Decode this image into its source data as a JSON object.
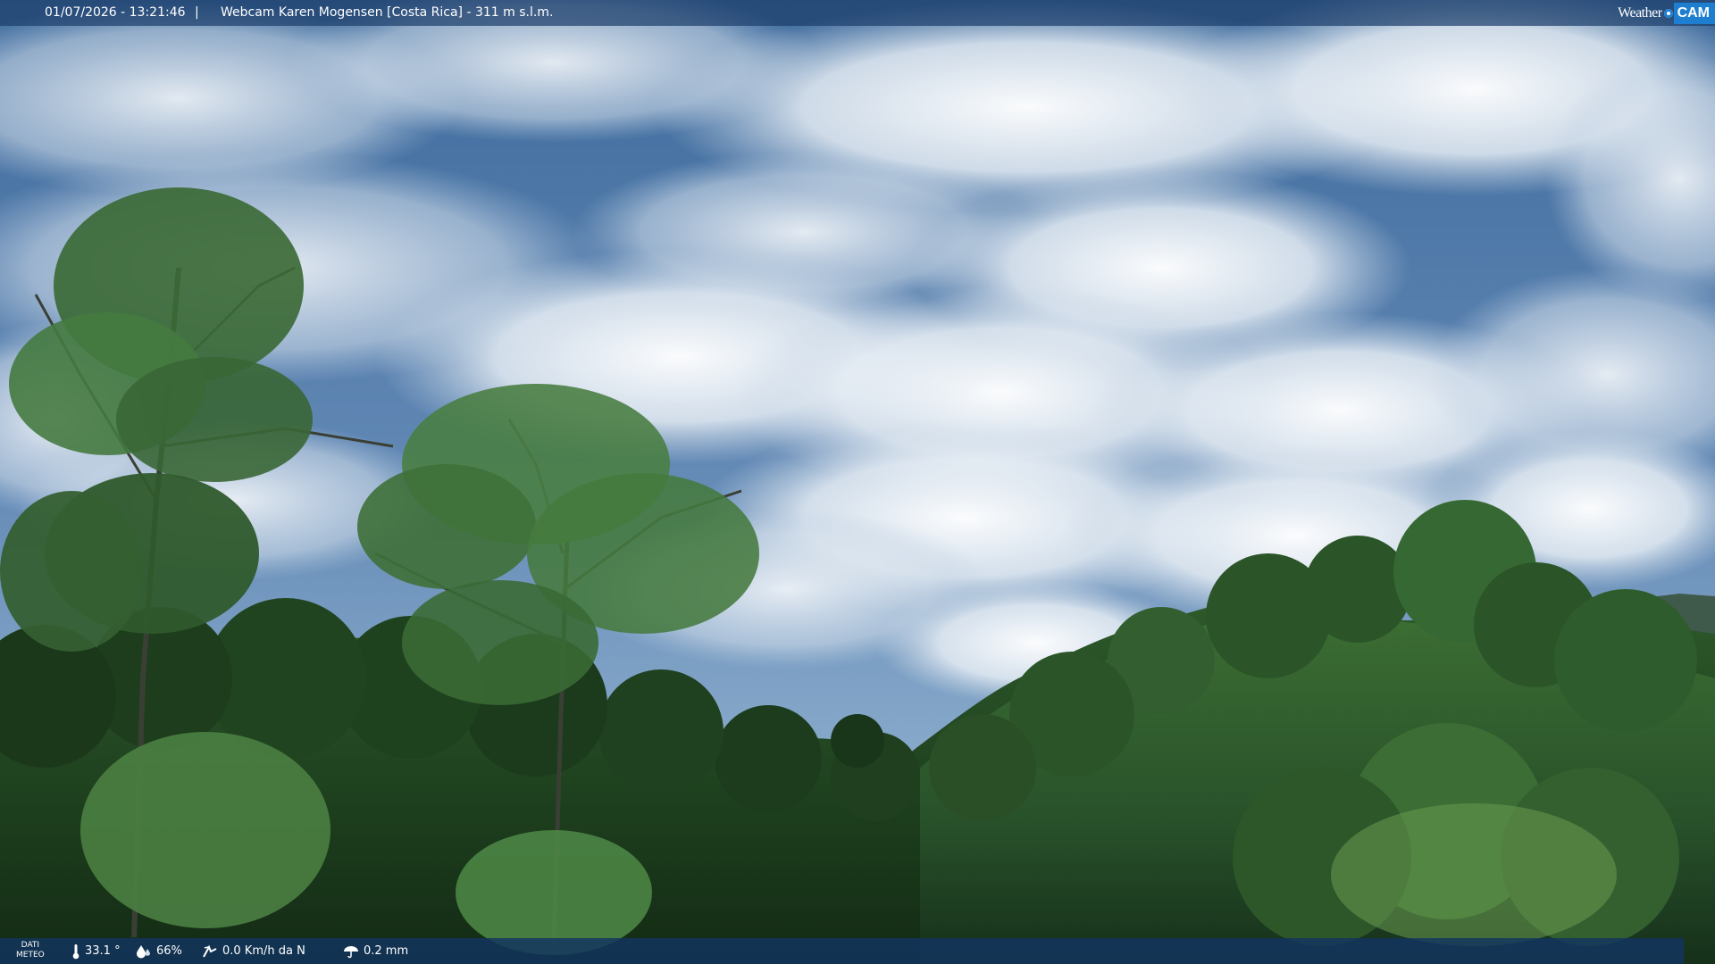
{
  "top_bar": {
    "datetime": "01/07/2026 - 13:21:46",
    "separator": "|",
    "title": "Webcam Karen Mogensen [Costa Rica] - 311 m s.l.m."
  },
  "logo": {
    "weather_text": "Weather",
    "cam_text": "CAM"
  },
  "meteo": {
    "label_line1": "DATI",
    "label_line2": "METEO",
    "temperature": "33.1 °",
    "humidity": "66%",
    "wind": "0.0 Km/h da N",
    "rain": "0.2 mm"
  },
  "scene": {
    "description_icon": "webcam-landscape",
    "colors": {
      "sky_top": "#3f6c9e",
      "sky_mid": "#7fa0c4",
      "cloud": "#eef2f6",
      "forest_dark": "#1d3a1c",
      "forest_mid": "#2f5a2a",
      "leaf_light": "#5d8f4f"
    }
  }
}
